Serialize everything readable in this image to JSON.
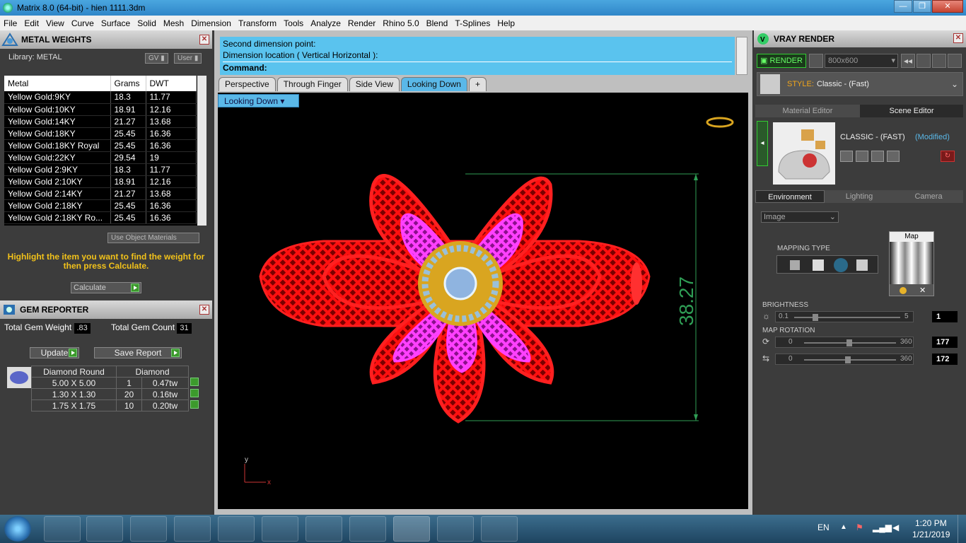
{
  "window": {
    "title": "Matrix 8.0 (64-bit) - hien 1111.3dm",
    "min": "—",
    "max": "❐",
    "close": "✕"
  },
  "menu": [
    "File",
    "Edit",
    "View",
    "Curve",
    "Surface",
    "Solid",
    "Mesh",
    "Dimension",
    "Transform",
    "Tools",
    "Analyze",
    "Render",
    "Rhino 5.0",
    "Blend",
    "T-Splines",
    "Help"
  ],
  "metal": {
    "title": "METAL WEIGHTS",
    "library": "Library: METAL",
    "gv": "GV",
    "user": "User",
    "headers": [
      "Metal",
      "Grams",
      "DWT"
    ],
    "rows": [
      [
        "Yellow Gold:9KY",
        "18.3",
        "11.77"
      ],
      [
        "Yellow Gold:10KY",
        "18.91",
        "12.16"
      ],
      [
        "Yellow Gold:14KY",
        "21.27",
        "13.68"
      ],
      [
        "Yellow Gold:18KY",
        "25.45",
        "16.36"
      ],
      [
        "Yellow Gold:18KY Royal",
        "25.45",
        "16.36"
      ],
      [
        "Yellow Gold:22KY",
        "29.54",
        "19"
      ],
      [
        "Yellow Gold 2:9KY",
        "18.3",
        "11.77"
      ],
      [
        "Yellow Gold 2:10KY",
        "18.91",
        "12.16"
      ],
      [
        "Yellow Gold 2:14KY",
        "21.27",
        "13.68"
      ],
      [
        "Yellow Gold 2:18KY",
        "25.45",
        "16.36"
      ],
      [
        "Yellow Gold 2:18KY Ro...",
        "25.45",
        "16.36"
      ]
    ],
    "use_object": "Use Object Materials",
    "hint": "Highlight the item you want to find the weight for then press Calculate.",
    "calculate": "Calculate"
  },
  "gem": {
    "title": "GEM REPORTER",
    "total_weight_label": "Total Gem Weight",
    "total_weight": ".83",
    "total_count_label": "Total Gem Count",
    "total_count": "31",
    "update": "Update",
    "save_report": "Save Report",
    "headers": [
      "Diamond Round",
      "Diamond"
    ],
    "rows": [
      [
        "5.00 X 5.00",
        "1",
        "0.47tw"
      ],
      [
        "1.30 X 1.30",
        "20",
        "0.16tw"
      ],
      [
        "1.75 X 1.75",
        "10",
        "0.20tw"
      ]
    ]
  },
  "command": {
    "line1": "Second dimension point:",
    "line2": "Dimension location ( Vertical  Horizontal ):",
    "prompt": "Command:"
  },
  "tabs": [
    "Perspective",
    "Through Finger",
    "Side View",
    "Looking Down",
    "+"
  ],
  "viewport": {
    "label": "Looking Down",
    "dimension": "38.27",
    "axis_y": "y",
    "axis_x": "x"
  },
  "vray": {
    "title": "VRAY RENDER",
    "render": "RENDER",
    "resolution": "800x600",
    "style_label": "STYLE:",
    "style_value": "Classic - (Fast)",
    "tabs": [
      "Material Editor",
      "Scene Editor"
    ],
    "scene_name": "CLASSIC - (FAST)",
    "scene_mod": "(Modified)",
    "env_tabs": [
      "Environment",
      "Lighting",
      "Camera"
    ],
    "env_select": "Image",
    "mapping_type": "MAPPING TYPE",
    "map": "Map",
    "brightness": "BRIGHTNESS",
    "b_min": "0.1",
    "b_max": "5",
    "b_val": "1",
    "map_rotation": "MAP ROTATION",
    "r1_min": "0",
    "r1_max": "360",
    "r1_val": "177",
    "r2_min": "0",
    "r2_max": "360",
    "r2_val": "172"
  },
  "tray": {
    "lang": "EN",
    "time": "1:20 PM",
    "date": "1/21/2019"
  },
  "colors": {
    "accent": "#5ab8e8",
    "gold": "#f2c21a",
    "green": "#3c9a2c",
    "red": "#ff1a1a",
    "magenta": "#e020e0",
    "dim": "#2f9e55"
  }
}
